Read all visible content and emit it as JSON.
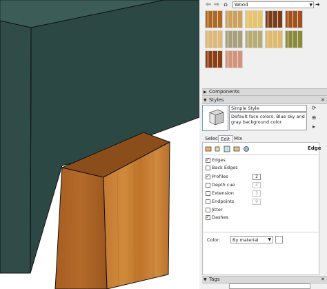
{
  "materials": {
    "collection": "Wood",
    "swatches": [
      {
        "name": "wood-swatch-1",
        "color": "#b06820"
      },
      {
        "name": "wood-swatch-2",
        "color": "#cfa05a"
      },
      {
        "name": "wood-swatch-3",
        "color": "#e8c46a"
      },
      {
        "name": "wood-swatch-4",
        "color": "#7a3d18"
      },
      {
        "name": "wood-swatch-5",
        "color": "#a34f1a"
      },
      {
        "name": "wood-swatch-6",
        "color": "#e0b978"
      },
      {
        "name": "wood-swatch-7",
        "color": "#a8a07a"
      },
      {
        "name": "wood-swatch-8",
        "color": "#b7ad72"
      },
      {
        "name": "wood-swatch-9",
        "color": "#e2b96a"
      },
      {
        "name": "wood-swatch-10",
        "color": "#8a8a38"
      },
      {
        "name": "wood-swatch-11",
        "color": "#8c3e12"
      },
      {
        "name": "wood-swatch-12",
        "color": "#d4937a"
      }
    ]
  },
  "panels": {
    "components": "Components",
    "styles": "Styles",
    "tags": "Tags"
  },
  "style": {
    "name": "Simple Style",
    "description": "Default face colors. Blue sky and gray background color."
  },
  "tabs": [
    "Select",
    "Edit",
    "Mix"
  ],
  "active_tab": "Edit",
  "edit": {
    "section_label": "Edge",
    "options": [
      {
        "label": "Edges",
        "checked": true
      },
      {
        "label": "Back Edges",
        "checked": false
      },
      {
        "label": "Profiles",
        "checked": true,
        "value": "2"
      },
      {
        "label": "Depth cue",
        "checked": false,
        "value": "4"
      },
      {
        "label": "Extension",
        "checked": false,
        "value": "3"
      },
      {
        "label": "Endpoints",
        "checked": false,
        "value": "9"
      },
      {
        "label": "Jitter",
        "checked": false
      },
      {
        "label": "Dashes",
        "checked": true
      }
    ],
    "color_label": "Color:",
    "color_value": "By material"
  },
  "scene": {
    "wall_color": "#2d4a46",
    "wall_top_color": "#3a5a55",
    "box_front": "#c67a2e",
    "box_side": "#a95f1f",
    "box_top": "#8c4c17"
  }
}
